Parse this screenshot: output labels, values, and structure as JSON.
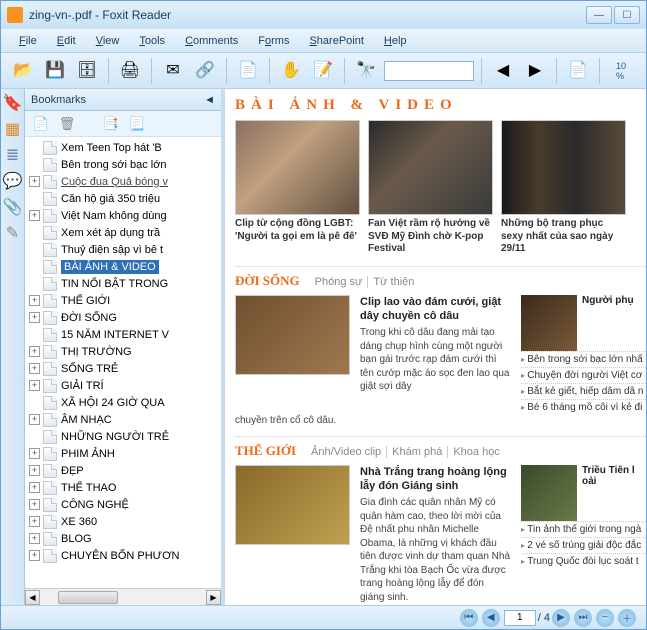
{
  "window": {
    "title": "zing-vn-.pdf - Foxit Reader"
  },
  "menu": {
    "file": "File",
    "edit": "Edit",
    "view": "View",
    "tools": "Tools",
    "comments": "Comments",
    "forms": "Forms",
    "sharepoint": "SharePoint",
    "help": "Help"
  },
  "bookmarks": {
    "header": "Bookmarks",
    "items": [
      {
        "label": "Xem Teen Top hát 'B",
        "exp": ""
      },
      {
        "label": "Bên trong sới bạc lớn",
        "exp": ""
      },
      {
        "label": "Cuộc đua Quả bóng v",
        "exp": "+",
        "visited": true
      },
      {
        "label": "Căn hộ giá 350 triệu",
        "exp": ""
      },
      {
        "label": "Việt Nam không dùng",
        "exp": "+"
      },
      {
        "label": "Xem xét áp dụng trầ",
        "exp": ""
      },
      {
        "label": "Thuỷ điện sập vì bê t",
        "exp": ""
      },
      {
        "label": "BÀI ẢNH & VIDEO",
        "exp": "",
        "selected": true
      },
      {
        "label": "TIN NỔI BẬT TRONG",
        "exp": ""
      },
      {
        "label": "THẾ GIỚI",
        "exp": "+"
      },
      {
        "label": "ĐỜI SỐNG",
        "exp": "+"
      },
      {
        "label": "15 NĂM INTERNET V",
        "exp": ""
      },
      {
        "label": "THỊ TRƯỜNG",
        "exp": "+"
      },
      {
        "label": "SỐNG TRẺ",
        "exp": "+"
      },
      {
        "label": "GIẢI TRÍ",
        "exp": "+"
      },
      {
        "label": "XÃ HỘI 24 GIỜ QUA",
        "exp": ""
      },
      {
        "label": "ÂM NHẠC",
        "exp": "+"
      },
      {
        "label": "NHỮNG NGƯỜI TRẺ",
        "exp": ""
      },
      {
        "label": "PHIM ẢNH",
        "exp": "+"
      },
      {
        "label": "ĐẸP",
        "exp": "+"
      },
      {
        "label": "THỂ THAO",
        "exp": "+"
      },
      {
        "label": "CÔNG NGHỆ",
        "exp": "+"
      },
      {
        "label": "XE 360",
        "exp": "+"
      },
      {
        "label": "BLOG",
        "exp": "+"
      },
      {
        "label": "CHUYÊN BỐN PHƯƠN",
        "exp": "+"
      }
    ]
  },
  "section_photo": {
    "title": "BÀI ẢNH & VIDEO",
    "thumbs": [
      {
        "cap": "Clip từ cộng đồng LGBT: 'Người ta gọi em là pê đê'"
      },
      {
        "cap": "Fan Việt rầm rộ hướng về SVĐ Mỹ Đình chờ K-pop Festival"
      },
      {
        "cap": "Những bộ trang phục sexy nhất của sao ngày 29/11"
      }
    ]
  },
  "section_doisong": {
    "title": "ĐỜI SỐNG",
    "tabs": [
      "Phóng sự",
      "Từ thiện"
    ],
    "story": {
      "hd": "Clip lao vào đám cưới, giật dây chuyền cô dâu",
      "body": "Trong khi cô dâu đang mải tạo dáng chụp hình cùng một người bạn gái trước rạp đám cưới thì tên cướp mặc áo sọc đen lao qua giật sợi dây",
      "more": "chuyền trên cổ cô dâu."
    },
    "right": {
      "hd": "Người phụ",
      "bullets": [
        "Bên trong sới bạc lớn nhấ",
        "Chuyện đời người Việt cơ",
        "Bắt kẻ giết, hiếp dâm dã n",
        "Bé 6 tháng mồ côi vì kẻ đi"
      ]
    }
  },
  "section_thegioi": {
    "title": "THẾ GIỚI",
    "tabs": [
      "Ảnh/Video clip",
      "Khám phá",
      "Khoa học"
    ],
    "story": {
      "hd": "Nhà Trắng trang hoàng lộng lẫy đón Giáng sinh",
      "body": "Gia đình các quân nhân Mỹ có quân hàm cao, theo lời mời của Đệ nhất phu nhân Michelle Obama, là những vị khách đầu tiên được vinh dự tham quan Nhà Trắng khi tòa Bạch Ốc vừa được trang hoàng lộng lẫy để đón giáng sinh."
    },
    "right": {
      "hd": "Triều Tiên l oải",
      "bullets": [
        "Tin ảnh thế giới trong ngà",
        "2 vé số trúng giải độc đắc",
        "Trung Quốc đòi lục soát t"
      ]
    }
  },
  "status": {
    "page_current": "1",
    "page_total": "/ 4"
  }
}
